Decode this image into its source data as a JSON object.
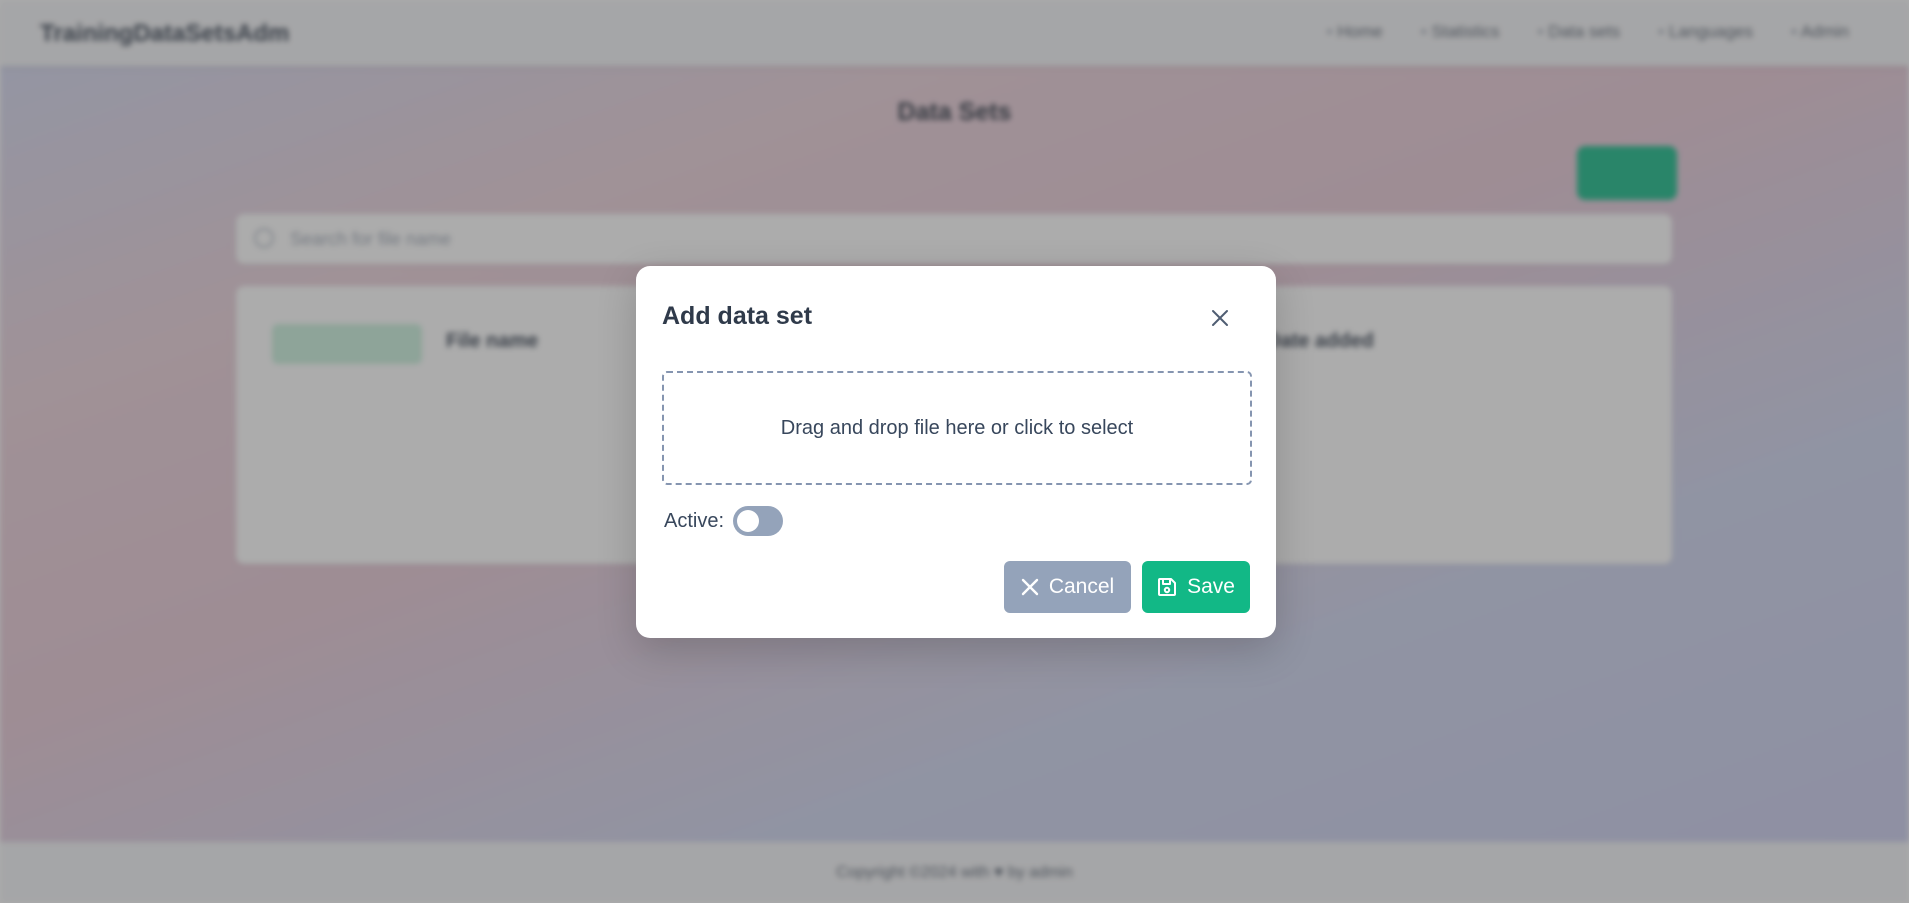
{
  "app": {
    "brand": "TrainingDataSetsAdm",
    "nav": [
      "Home",
      "Statistics",
      "Data sets",
      "Languages",
      "Admin"
    ],
    "page_title": "Data Sets",
    "search_placeholder": "Search for file name",
    "table_columns": [
      "File name",
      "Date added"
    ],
    "footer_text": "Copyright ©2024 with ♥ by admin"
  },
  "modal": {
    "title": "Add data set",
    "dropzone_text": "Drag and drop file here or click to select",
    "active_label": "Active:",
    "active_value": false,
    "cancel_label": "Cancel",
    "save_label": "Save",
    "colors": {
      "primary": "#12b886",
      "secondary": "#94a3ba",
      "text": "#2f3a4a"
    },
    "icons": {
      "close": "close-icon",
      "cancel": "x-icon",
      "save": "save-icon"
    }
  }
}
